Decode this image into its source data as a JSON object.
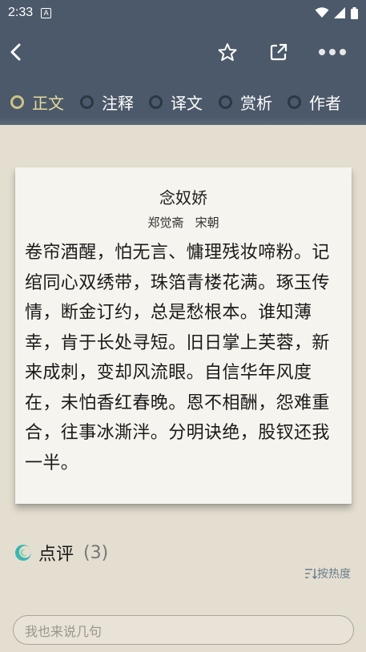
{
  "status_bar": {
    "time": "2:33",
    "notification_letter": "A"
  },
  "header": {
    "back_icon": "chevron-left-icon",
    "star_icon": "star-outline-icon",
    "share_icon": "share-external-icon",
    "more_icon": "more-dots-icon"
  },
  "tabs": [
    {
      "label": "正文",
      "active": true
    },
    {
      "label": "注释",
      "active": false
    },
    {
      "label": "译文",
      "active": false
    },
    {
      "label": "赏析",
      "active": false
    },
    {
      "label": "作者",
      "active": false
    }
  ],
  "poem": {
    "title": "念奴娇",
    "author": "郑觉斋   宋朝",
    "body": "卷帘酒醒，怕无言、慵理残妆啼粉。记绾同心双绣带，珠箔青楼花满。琢玉传情，断金订约，总是愁根本。谁知薄幸，肯于长处寻短。旧日掌上芙蓉，新来成刺，变却风流眼。自信华年风度在，未怕香红春晚。恩不相酬，怨难重合，往事冰澌泮。分明诀绝，股钗还我一半。"
  },
  "comments": {
    "title": "点评",
    "count": "(3)",
    "sort_label": "按热度",
    "input_placeholder": "我也来说几句"
  },
  "colors": {
    "header_bg": "#4c596a",
    "active_tab": "#e6dc9c",
    "page_bg": "#e4ded0",
    "card_bg": "#f6f4ee"
  }
}
